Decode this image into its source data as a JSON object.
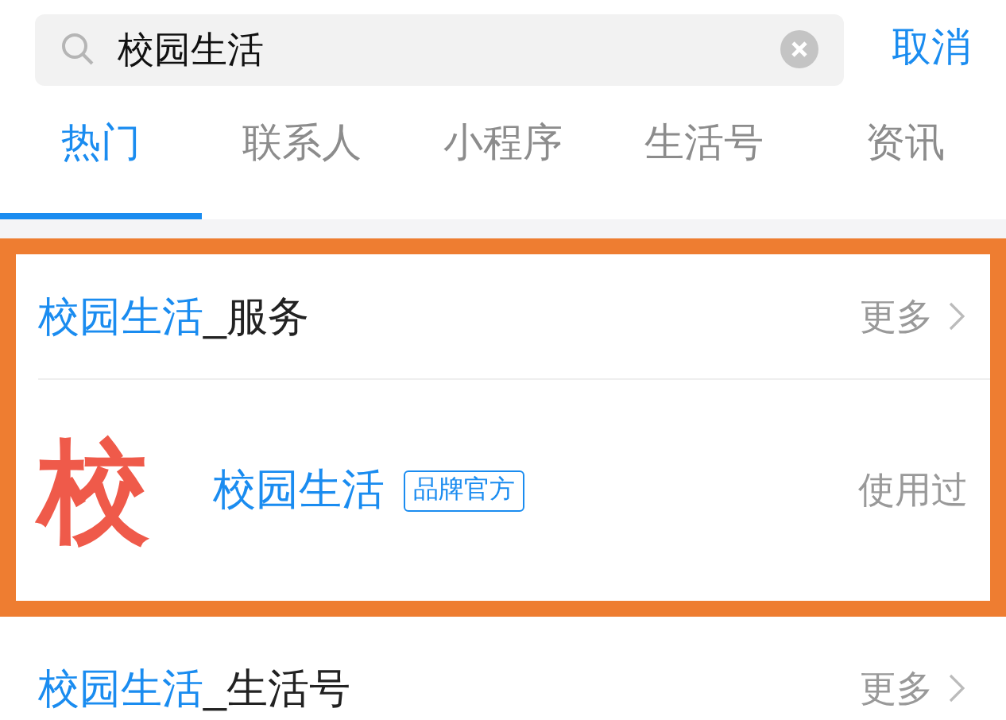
{
  "search": {
    "value": "校园生活",
    "cancel": "取消"
  },
  "tabs": [
    {
      "label": "热门",
      "selected": true
    },
    {
      "label": "联系人",
      "selected": false
    },
    {
      "label": "小程序",
      "selected": false
    },
    {
      "label": "生活号",
      "selected": false
    },
    {
      "label": "资讯",
      "selected": false
    }
  ],
  "sections": [
    {
      "highlighted": true,
      "keyword": "校园生活",
      "suffix": "_服务",
      "more": "更多",
      "items": [
        {
          "logo_text": "校",
          "name": "校园生活",
          "badge": "品牌官方",
          "status": "使用过"
        }
      ]
    },
    {
      "highlighted": false,
      "keyword": "校园生活",
      "suffix": "_生活号",
      "more": "更多"
    }
  ]
}
